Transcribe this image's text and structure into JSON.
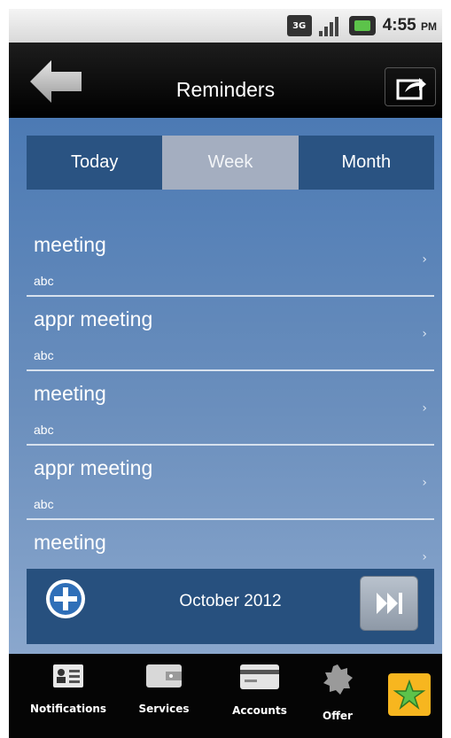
{
  "status_bar": {
    "network": "3G",
    "time": "4:55",
    "ampm": "PM"
  },
  "header": {
    "title": "Reminders",
    "back_icon": "back-arrow-icon",
    "share_icon": "share-icon"
  },
  "tabs": [
    {
      "label": "Today",
      "active": false
    },
    {
      "label": "Week",
      "active": true
    },
    {
      "label": "Month",
      "active": false
    }
  ],
  "reminders": [
    {
      "title": "meeting",
      "subtitle": "abc"
    },
    {
      "title": "appr meeting",
      "subtitle": "abc"
    },
    {
      "title": "meeting",
      "subtitle": "abc"
    },
    {
      "title": "appr meeting",
      "subtitle": "abc"
    },
    {
      "title": "meeting",
      "subtitle": ""
    }
  ],
  "footer": {
    "month": "October 2012",
    "add_icon": "plus-circle-icon",
    "next_icon": "skip-forward-icon"
  },
  "nav": [
    {
      "label": "Notifications",
      "icon": "contact-card-icon"
    },
    {
      "label": "Services",
      "icon": "wallet-icon"
    },
    {
      "label": "Accounts",
      "icon": "card-icon"
    },
    {
      "label": "Offer",
      "icon": "gear-badge-icon"
    }
  ],
  "colors": {
    "tab_bg": "#2a5382",
    "tab_active_bg": "#a4aec0",
    "content_top": "#4c7ab4",
    "content_bottom": "#8aa7cd",
    "star_bg": "#f7b61f",
    "star_fill": "#5cc34a"
  }
}
